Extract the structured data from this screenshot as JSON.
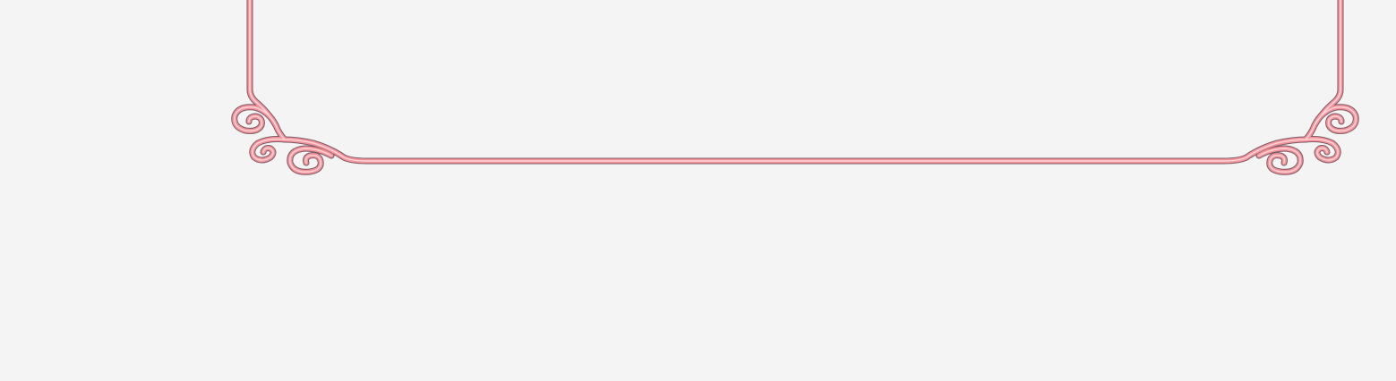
{
  "background_color": "#f4f4f4",
  "frame": {
    "stroke_color": "#f4939a",
    "shadow_color": "#7a5a66",
    "highlight_color": "#fbd4d8",
    "ornament": "curl-scroll"
  }
}
